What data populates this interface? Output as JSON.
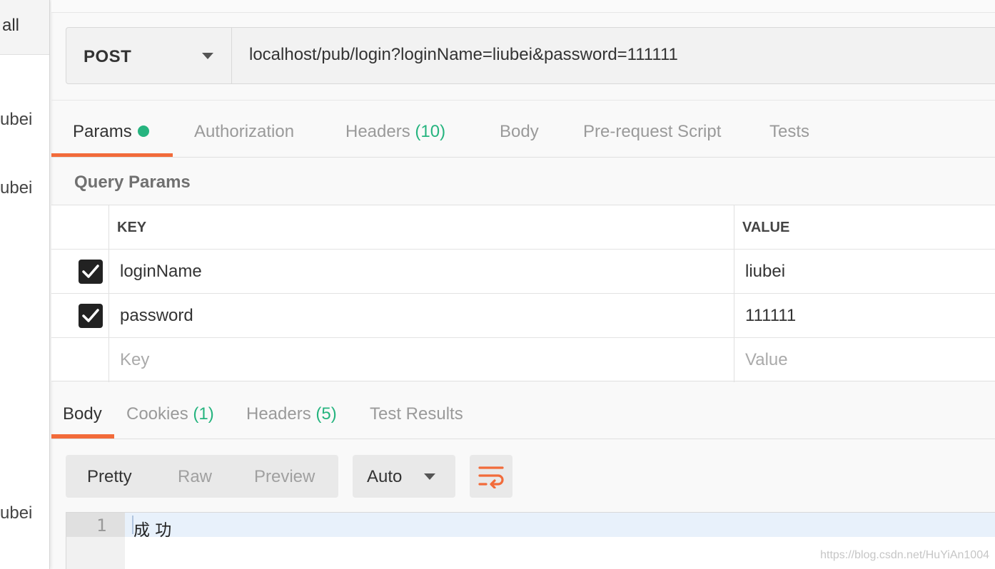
{
  "sidebar": {
    "top_text": "all",
    "items": [
      "ubei",
      "ubei",
      "ubei"
    ]
  },
  "request": {
    "method": "POST",
    "url": "localhost/pub/login?loginName=liubei&password=111111"
  },
  "request_tabs": {
    "params": "Params",
    "authorization": "Authorization",
    "headers": "Headers",
    "headers_count": "(10)",
    "body": "Body",
    "prerequest": "Pre-request Script",
    "tests": "Tests"
  },
  "query_params": {
    "title": "Query Params",
    "columns": {
      "key": "KEY",
      "value": "VALUE"
    },
    "rows": [
      {
        "key": "loginName",
        "value": "liubei",
        "checked": true
      },
      {
        "key": "password",
        "value": "111111",
        "checked": true
      }
    ],
    "placeholder": {
      "key": "Key",
      "value": "Value"
    }
  },
  "response_tabs": {
    "body": "Body",
    "cookies": "Cookies",
    "cookies_count": "(1)",
    "headers": "Headers",
    "headers_count": "(5)",
    "test_results": "Test Results"
  },
  "response_toolbar": {
    "views": [
      "Pretty",
      "Raw",
      "Preview"
    ],
    "active_view": "Pretty",
    "format": "Auto",
    "wrap_icon": "wrap-lines-icon"
  },
  "response_body": {
    "lines": [
      {
        "number": "1",
        "text": "成 功"
      }
    ]
  },
  "watermark": "https://blog.csdn.net/HuYiAn1004",
  "colors": {
    "accent": "#f26b3a",
    "count_green": "#26b47f"
  }
}
